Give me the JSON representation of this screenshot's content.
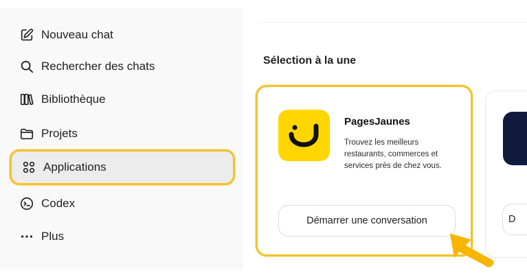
{
  "sidebar": {
    "items": [
      {
        "label": "Nouveau chat",
        "icon": "new-chat-icon",
        "active": false
      },
      {
        "label": "Rechercher des chats",
        "icon": "search-icon",
        "active": false
      },
      {
        "label": "Bibliothèque",
        "icon": "library-icon",
        "active": false
      },
      {
        "label": "Projets",
        "icon": "folder-icon",
        "active": false
      },
      {
        "label": "Applications",
        "icon": "apps-icon",
        "active": true
      },
      {
        "label": "Codex",
        "icon": "codex-icon",
        "active": false
      },
      {
        "label": "Plus",
        "icon": "more-icon",
        "active": false
      }
    ]
  },
  "main": {
    "section_title": "Sélection à la une",
    "featured": [
      {
        "name": "PagesJaunes",
        "description": "Trouvez les meilleurs restaurants, commerces et services près de chez vous.",
        "button_label": "Démarrer une conversation",
        "logo_color": "#ffd600",
        "icon": "pagesjaunes-logo-icon"
      },
      {
        "name": "",
        "button_label": "D",
        "logo_color": "#0f1a3c"
      }
    ]
  },
  "colors": {
    "highlight": "#f2c230",
    "sidebar_bg": "#f9f9f9",
    "active_bg": "#ececec",
    "cursor": "#f7b500"
  }
}
